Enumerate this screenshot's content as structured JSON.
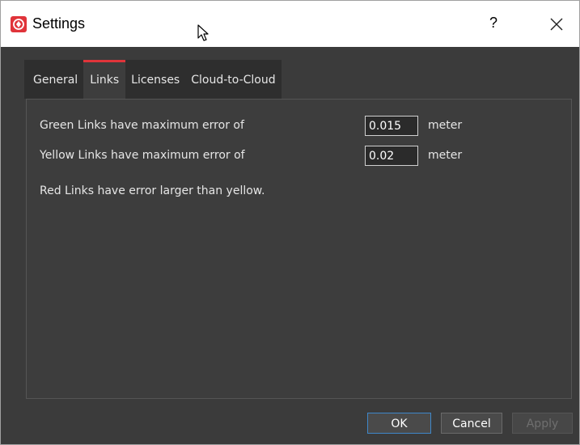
{
  "window": {
    "title": "Settings",
    "help_label": "?"
  },
  "tabs": [
    {
      "label": "General"
    },
    {
      "label": "Links",
      "active": true
    },
    {
      "label": "Licenses"
    },
    {
      "label": "Cloud-to-Cloud"
    }
  ],
  "links": {
    "green": {
      "label": "Green Links have maximum error of",
      "value": "0.015",
      "unit": "meter"
    },
    "yellow": {
      "label": "Yellow Links have maximum error of",
      "value": "0.02",
      "unit": "meter"
    },
    "red_note": "Red Links have error larger than yellow."
  },
  "buttons": {
    "ok": "OK",
    "cancel": "Cancel",
    "apply": "Apply"
  },
  "colors": {
    "accent": "#e0343a",
    "focus": "#3f87c9",
    "background": "#3b3b3b"
  },
  "icons": [
    "app-logo-icon",
    "help-icon",
    "close-icon",
    "mouse-cursor-icon"
  ]
}
